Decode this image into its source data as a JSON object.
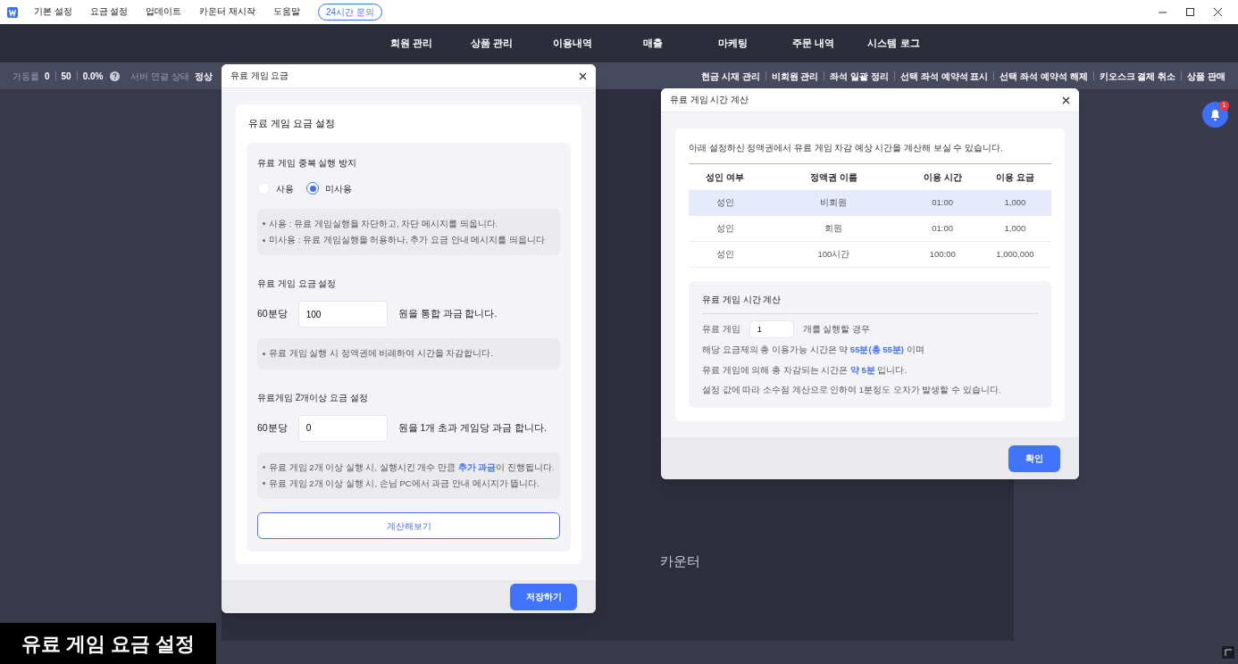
{
  "menu_bar": {
    "items": [
      "기본 설정",
      "요금 설정",
      "업데이트",
      "카운터 재시작",
      "도움말"
    ],
    "inquiry_button": "24시간 문의"
  },
  "nav": {
    "items": [
      "회원 관리",
      "상품 관리",
      "이용내역",
      "매출",
      "마케팅",
      "주문 내역",
      "시스템 로그"
    ]
  },
  "status_bar": {
    "rate_label": "가동률",
    "rate_values": [
      "0",
      "50",
      "0.0%"
    ],
    "server_label": "서버 연결 상태",
    "server_value": "정상",
    "actions": [
      "현금 시재 관리",
      "비회원 관리",
      "좌석 일괄 정리",
      "선택 좌석 예약석 표시",
      "선택 좌석 예약석 해제",
      "키오스크 결제 취소",
      "상품 판매"
    ]
  },
  "notification": {
    "count": "1"
  },
  "background": {
    "counter_label": "카운터"
  },
  "fee_dialog": {
    "title": "유료 게임 요금",
    "card_title": "유료 게임 요금 설정",
    "duplicate": {
      "title": "유료 게임 중복 실행 방지",
      "options": [
        {
          "label": "사용",
          "selected": false
        },
        {
          "label": "미사용",
          "selected": true
        }
      ],
      "notes": [
        [
          {
            "text": "사용 : 유료 게임실행을 차단하고, 차단 메시지를 띄웁니다.",
            "highlight": false
          }
        ],
        [
          {
            "text": "미사용 : 유료 게임실행을 허용하나, 추가 요금 안내 메시지를 띄웁니다",
            "highlight": false
          }
        ]
      ]
    },
    "rate": {
      "title": "유료 게임 요금 설정",
      "prefix": "60분당",
      "value": "100",
      "suffix": "원을 통합 과금 합니다.",
      "notes": [
        [
          {
            "text": "유료 게임 실행 시 정액권에 비례하여 시간을 차감합니다.",
            "highlight": false
          }
        ]
      ]
    },
    "multi": {
      "title": "유료게임 2개이상 요금 설정",
      "prefix": "60분당",
      "value": "0",
      "suffix": "원을 1개 초과 게임당 과금 합니다.",
      "notes": [
        [
          {
            "text": "유료 게임 2개 이상 실행 시, 실행시킨 개수 만큼 ",
            "highlight": false
          },
          {
            "text": "추가 과금",
            "highlight": true
          },
          {
            "text": "이 진행됩니다.",
            "highlight": false
          }
        ],
        [
          {
            "text": "유료 게임 2개 이상 실행 시, 손님 PC에서 과금 안내 메시지가 뜹니다.",
            "highlight": false
          }
        ]
      ]
    },
    "calc_button": "계산해보기",
    "save_button": "저장하기"
  },
  "calc_dialog": {
    "title": "유료 게임 시간 계산",
    "intro": "아래 설정하신 정액권에서 유료 게임 차감 예상 시간을 계산해 보실 수 있습니다.",
    "table": {
      "columns": [
        "성인 여부",
        "정액권 이름",
        "이용 시간",
        "이용 요금"
      ],
      "rows": [
        {
          "cells": [
            "성인",
            "비회원",
            "01:00",
            "1,000"
          ],
          "selected": true
        },
        {
          "cells": [
            "성인",
            "회원",
            "01:00",
            "1,000"
          ],
          "selected": false
        },
        {
          "cells": [
            "성인",
            "100시간",
            "100:00",
            "1,000,000"
          ],
          "selected": false
        }
      ]
    },
    "calc": {
      "title": "유료 게임 시간 계산",
      "prefix": "유료 게임",
      "value": "1",
      "suffix": "개를 실행할 경우",
      "lines": [
        [
          {
            "text": "해당 요금제의 총 이용가능 시간은 약 ",
            "highlight": false
          },
          {
            "text": "55분(총 55분)",
            "highlight": true
          },
          {
            "text": " 이며",
            "highlight": false
          }
        ],
        [
          {
            "text": "유료 게임에 의해 총 차감되는 시간은 ",
            "highlight": false
          },
          {
            "text": "약 5분",
            "highlight": true
          },
          {
            "text": " 입니다.",
            "highlight": false
          }
        ],
        [
          {
            "text": "설정 값에 따라 소수점 계산으로 인하여 1분정도 오차가 발생할 수 있습니다.",
            "highlight": false
          }
        ]
      ]
    },
    "ok_button": "확인"
  },
  "caption": "유료 게임 요금 설정"
}
